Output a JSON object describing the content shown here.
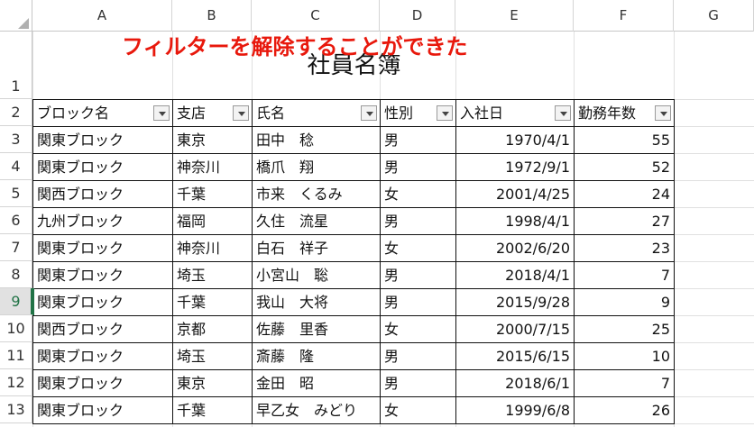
{
  "columns": [
    "A",
    "B",
    "C",
    "D",
    "E",
    "F",
    "G"
  ],
  "rows": [
    "1",
    "2",
    "3",
    "4",
    "5",
    "6",
    "7",
    "8",
    "9",
    "10",
    "11",
    "12",
    "13"
  ],
  "active_row": "9",
  "annotation": "フィルターを解除することができた",
  "title": "社員名簿",
  "headers": [
    "ブロック名",
    "支店",
    "氏名",
    "性別",
    "入社日",
    "勤務年数"
  ],
  "records": [
    [
      "関東ブロック",
      "東京",
      "田中　稔",
      "男",
      "1970/4/1",
      "55"
    ],
    [
      "関東ブロック",
      "神奈川",
      "橋爪　翔",
      "男",
      "1972/9/1",
      "52"
    ],
    [
      "関西ブロック",
      "千葉",
      "市来　くるみ",
      "女",
      "2001/4/25",
      "24"
    ],
    [
      "九州ブロック",
      "福岡",
      "久住　流星",
      "男",
      "1998/4/1",
      "27"
    ],
    [
      "関東ブロック",
      "神奈川",
      "白石　祥子",
      "女",
      "2002/6/20",
      "23"
    ],
    [
      "関東ブロック",
      "埼玉",
      "小宮山　聡",
      "男",
      "2018/4/1",
      "7"
    ],
    [
      "関東ブロック",
      "千葉",
      "我山　大将",
      "男",
      "2015/9/28",
      "9"
    ],
    [
      "関西ブロック",
      "京都",
      "佐藤　里香",
      "女",
      "2000/7/15",
      "25"
    ],
    [
      "関東ブロック",
      "埼玉",
      "斎藤　隆",
      "男",
      "2015/6/15",
      "10"
    ],
    [
      "関東ブロック",
      "東京",
      "金田　昭",
      "男",
      "2018/6/1",
      "7"
    ],
    [
      "関東ブロック",
      "千葉",
      "早乙女　みどり",
      "女",
      "1999/6/8",
      "26"
    ]
  ],
  "colors": {
    "accent": "#217346",
    "annotation": "#e8180c"
  }
}
